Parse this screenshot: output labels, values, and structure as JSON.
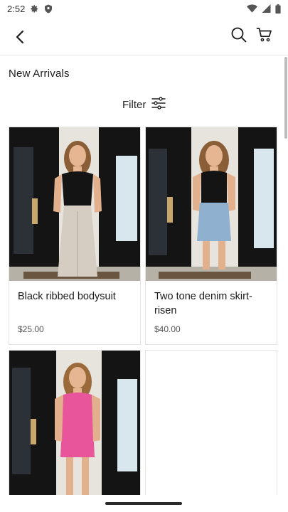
{
  "status_bar": {
    "time": "2:52",
    "icons": [
      "gear-icon",
      "shield-icon",
      "wifi-icon",
      "signal-icon",
      "battery-icon"
    ]
  },
  "app_bar": {
    "icons": [
      "back-arrow-icon",
      "search-icon",
      "cart-icon"
    ]
  },
  "page": {
    "title": "New Arrivals",
    "filter_label": "Filter",
    "filter_icon": "sliders-icon"
  },
  "products": [
    {
      "name": "Black ribbed bodysuit",
      "price": "$25.00",
      "top_color": "#111111",
      "bottom_color": "#d6cdc2"
    },
    {
      "name": "Two tone denim skirt- risen",
      "price": "$40.00",
      "top_color": "#111111",
      "bottom_color": "#8fb0cf"
    },
    {
      "name": "",
      "price": "",
      "top_color": "#e9559a",
      "bottom_color": "#e9559a"
    }
  ],
  "colors": {
    "divider": "#e6e6e6",
    "text": "#1a1a1a",
    "price": "#555555"
  }
}
